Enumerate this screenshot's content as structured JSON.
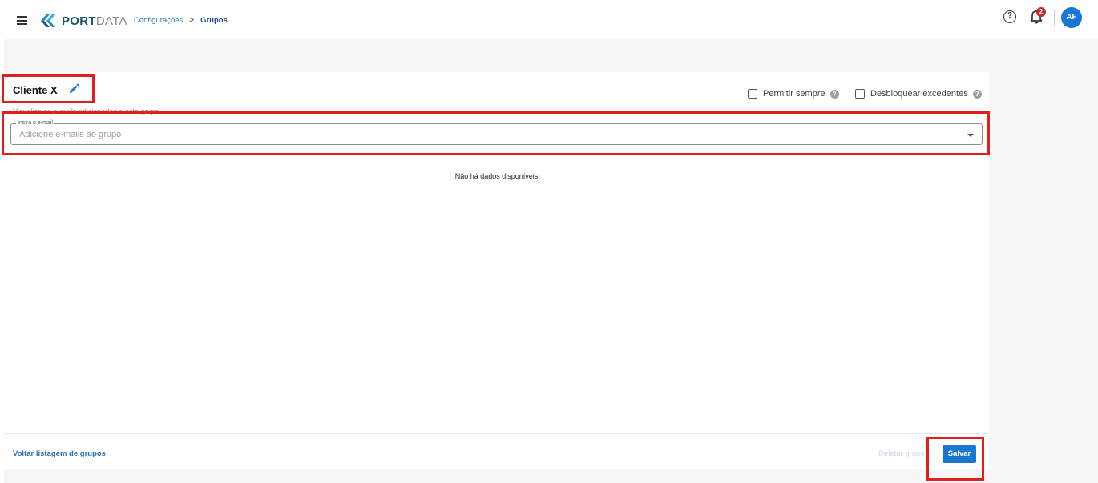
{
  "header": {
    "logo_port": "PORT",
    "logo_data": "DATA",
    "breadcrumb_parent": "Configurações",
    "breadcrumb_separator": ">",
    "breadcrumb_current": "Grupos",
    "help_glyph": "?",
    "notification_count": "2",
    "avatar_initials": "AF"
  },
  "group": {
    "title": "Cliente X",
    "subtitle": "Visualize os e-mails adicionados a este grupo"
  },
  "options": {
    "permitir_sempre": "Permitir sempre",
    "desbloquear_excedentes": "Desbloquear excedentes",
    "help_glyph": "?"
  },
  "email_input": {
    "label": "Insira o e-mail",
    "placeholder": "Adicione e-mails ao grupo"
  },
  "table": {
    "empty_message": "Não há dados disponíveis"
  },
  "footer": {
    "back_label": "Voltar listagem de grupos",
    "delete_label": "Deletar grupo",
    "save_label": "Salvar"
  },
  "colors": {
    "primary": "#1976d2",
    "link": "#2a6fb5",
    "highlight": "#e41e1e",
    "badge": "#c62828"
  }
}
